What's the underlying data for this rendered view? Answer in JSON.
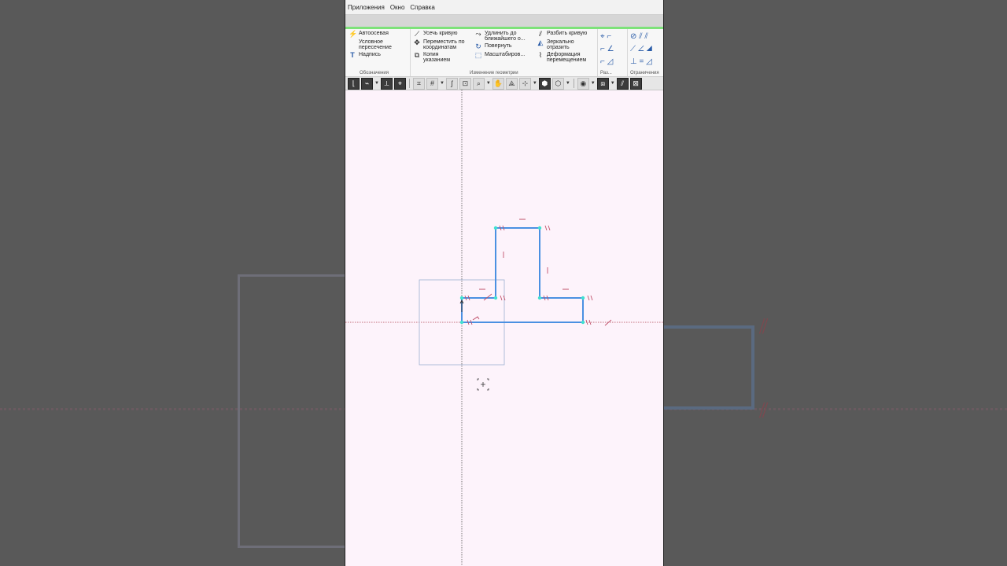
{
  "menu": [
    "Приложения",
    "Окно",
    "Справка"
  ],
  "ribbon": {
    "group1": {
      "items": [
        "Автоосевая",
        "Условное пересечение",
        "Надпись"
      ],
      "label": "Обозначения"
    },
    "group2": {
      "col1": [
        "Усечь кривую",
        "Переместить по координатам",
        "Копия указанием"
      ],
      "col2": [
        "Удлинить до ближайшего о...",
        "Повернуть",
        "Масштабиров..."
      ],
      "col3": [
        "Разбить кривую",
        "Зеркально отразить",
        "Деформация перемещением"
      ],
      "label": "Изменение геометрии"
    },
    "group3": {
      "label": "Раз..."
    },
    "group4": {
      "label": "Ограничения"
    }
  },
  "colors": {
    "accent_green": "#7ee27a",
    "canvas_bg": "#fdf3fb",
    "sketch_line": "#4a90e2",
    "constraint_mark": "#c0506a"
  },
  "icons": [
    "sketch-icon",
    "measure-icon",
    "ruler-icon",
    "zoom-icon",
    "grid-icon",
    "view-icon",
    "hide-icon",
    "cube-icon"
  ]
}
